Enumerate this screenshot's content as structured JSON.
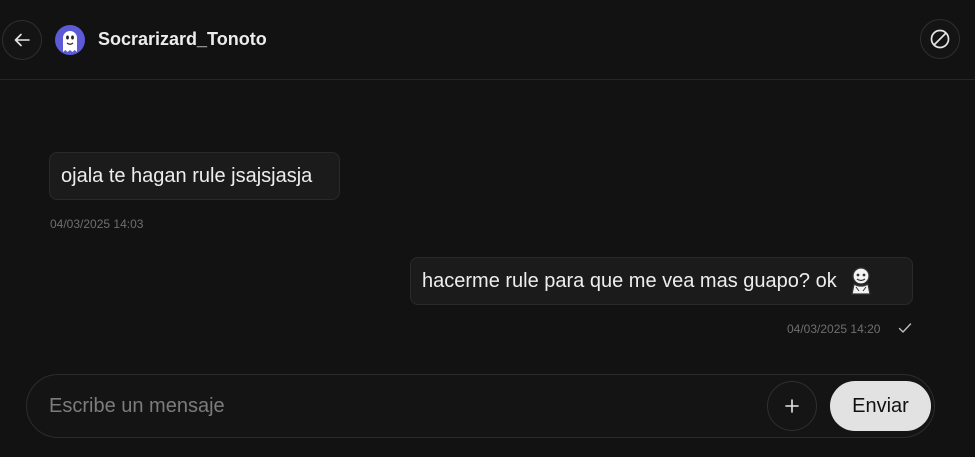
{
  "header": {
    "username": "Socrarizard_Tonoto",
    "back_icon": "arrow-left-icon",
    "block_icon": "block-icon"
  },
  "messages": [
    {
      "text": "ojala te hagan rule jsajsjasja",
      "timestamp": "04/03/2025 14:03",
      "side": "received"
    },
    {
      "text": "hacerme rule para que me vea mas guapo? ok",
      "timestamp": "04/03/2025 14:20",
      "side": "sent",
      "sticker": "sticker-icon",
      "status_icon": "check-icon"
    }
  ],
  "composer": {
    "placeholder": "Escribe un mensaje",
    "value": "",
    "add_icon": "plus-icon",
    "send_label": "Enviar"
  },
  "colors": {
    "background": "#121212",
    "bubble": "#1b1b1b",
    "avatar": "#5c5ad6",
    "send_button": "#e2e2e2"
  }
}
